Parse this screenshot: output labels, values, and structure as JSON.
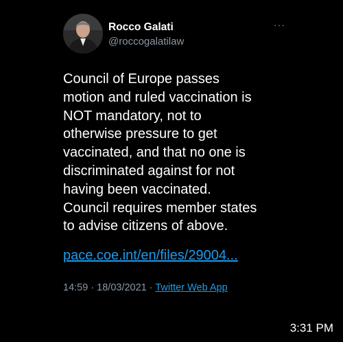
{
  "tweet": {
    "author": {
      "display_name": "Rocco Galati",
      "handle": "@roccogalatilaw",
      "avatar_icon": "profile-photo"
    },
    "more_label": "···",
    "body_lines": [
      "Council of Europe passes",
      "motion and ruled  vaccination is",
      "NOT mandatory, not to",
      "otherwise pressure  to get",
      "vaccinated, and that no one is",
      "discriminated against for not",
      "having been vaccinated.",
      "Council requires member states",
      "to advise citizens of above."
    ],
    "link": "pace.coe.int/en/files/29004...",
    "timestamp": "14:59 · 18/03/2021 · ",
    "source": "Twitter Web App"
  },
  "status_bar": {
    "time": "3:31 PM"
  },
  "colors": {
    "background": "#000000",
    "text": "#ffffff",
    "secondary": "#8b98a5",
    "link": "#1d9bf0"
  }
}
